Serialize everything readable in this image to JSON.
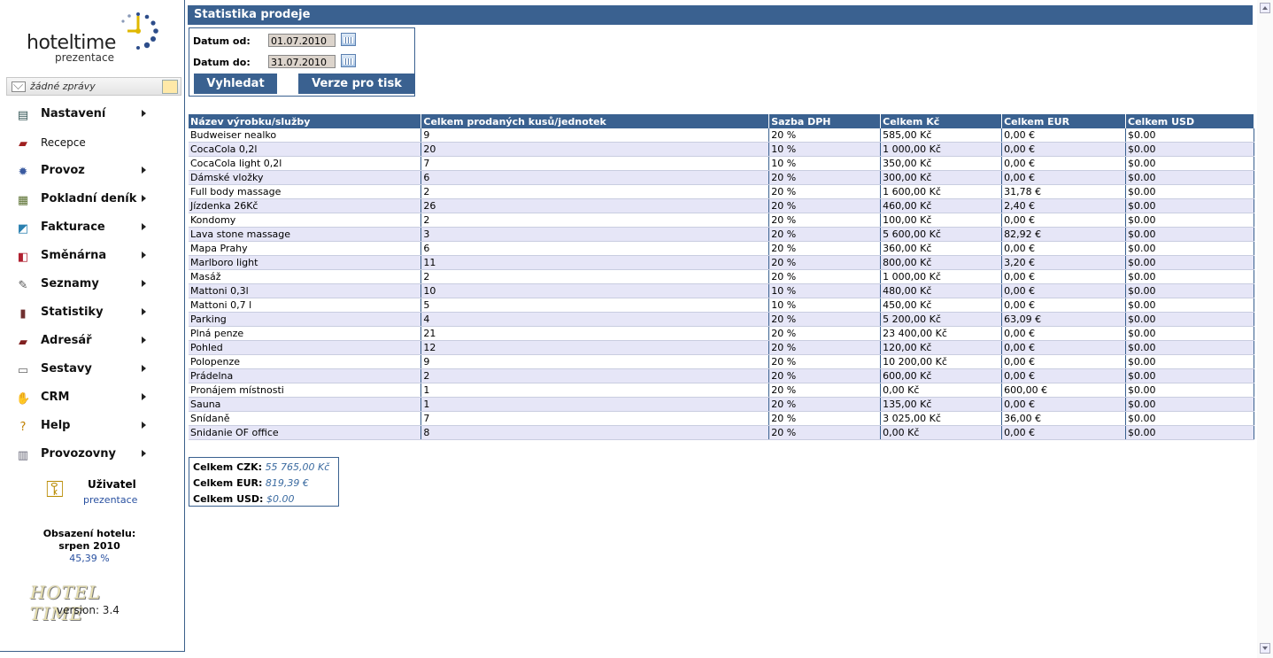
{
  "app": {
    "logo_text": "hoteltime",
    "logo_sub": "prezentace"
  },
  "messages": {
    "text": "žádné zprávy"
  },
  "menu": [
    {
      "label": "Nastavení",
      "icon": "settings-list-icon",
      "glyph": "▤",
      "color": "#355",
      "arrow": true
    },
    {
      "label": "Recepce",
      "icon": "reception-icon",
      "glyph": "▰",
      "color": "#a02020",
      "arrow": false
    },
    {
      "label": "Provoz",
      "icon": "gear-icon",
      "glyph": "✹",
      "color": "#3a5aa0",
      "arrow": true
    },
    {
      "label": "Pokladní deník",
      "icon": "cash-book-icon",
      "glyph": "▦",
      "color": "#5a7030",
      "arrow": true
    },
    {
      "label": "Fakturace",
      "icon": "invoice-icon",
      "glyph": "◩",
      "color": "#2a80b0",
      "arrow": true
    },
    {
      "label": "Směnárna",
      "icon": "exchange-icon",
      "glyph": "◧",
      "color": "#b02030",
      "arrow": true
    },
    {
      "label": "Seznamy",
      "icon": "lists-icon",
      "glyph": "✎",
      "color": "#555",
      "arrow": true
    },
    {
      "label": "Statistiky",
      "icon": "statistics-icon",
      "glyph": "▮",
      "color": "#703030",
      "arrow": true
    },
    {
      "label": "Adresář",
      "icon": "address-book-icon",
      "glyph": "▰",
      "color": "#802020",
      "arrow": true
    },
    {
      "label": "Sestavy",
      "icon": "printer-icon",
      "glyph": "▭",
      "color": "#666",
      "arrow": true
    },
    {
      "label": "CRM",
      "icon": "crm-icon",
      "glyph": "✋",
      "color": "#d0a000",
      "arrow": true
    },
    {
      "label": "Help",
      "icon": "help-icon",
      "glyph": "?",
      "color": "#c08000",
      "arrow": true
    },
    {
      "label": "Provozovny",
      "icon": "building-icon",
      "glyph": "▥",
      "color": "#667",
      "arrow": true
    }
  ],
  "user": {
    "title": "Uživatel",
    "name": "prezentace"
  },
  "occupancy": {
    "heading_1": "Obsazení hotelu:",
    "heading_2": "srpen 2010",
    "percent": "45,39 %"
  },
  "brand": {
    "text": "HOTEL TIME",
    "version": "version: 3.4"
  },
  "page": {
    "title": "Statistika prodeje"
  },
  "filter": {
    "from_label": "Datum od:",
    "from_value": "01.07.2010",
    "to_label": "Datum do:",
    "to_value": "31.07.2010",
    "search_button": "Vyhledat",
    "print_button": "Verze pro tisk"
  },
  "table": {
    "columns": [
      "Název výrobku/služby",
      "Celkem prodaných kusů/jednotek",
      "Sazba DPH",
      "Celkem Kč",
      "Celkem EUR",
      "Celkem USD"
    ],
    "rows": [
      [
        "Budweiser nealko",
        "9",
        "20 %",
        "585,00 Kč",
        "0,00 €",
        "$0.00"
      ],
      [
        "CocaCola 0,2l",
        "20",
        "10 %",
        "1 000,00 Kč",
        "0,00 €",
        "$0.00"
      ],
      [
        "CocaCola light 0,2l",
        "7",
        "10 %",
        "350,00 Kč",
        "0,00 €",
        "$0.00"
      ],
      [
        "Dámské vložky",
        "6",
        "20 %",
        "300,00 Kč",
        "0,00 €",
        "$0.00"
      ],
      [
        "Full body massage",
        "2",
        "20 %",
        "1 600,00 Kč",
        "31,78 €",
        "$0.00"
      ],
      [
        "Jízdenka 26Kč",
        "26",
        "20 %",
        "460,00 Kč",
        "2,40 €",
        "$0.00"
      ],
      [
        "Kondomy",
        "2",
        "20 %",
        "100,00 Kč",
        "0,00 €",
        "$0.00"
      ],
      [
        "Lava stone massage",
        "3",
        "20 %",
        "5 600,00 Kč",
        "82,92 €",
        "$0.00"
      ],
      [
        "Mapa Prahy",
        "6",
        "20 %",
        "360,00 Kč",
        "0,00 €",
        "$0.00"
      ],
      [
        "Marlboro light",
        "11",
        "20 %",
        "800,00 Kč",
        "3,20 €",
        "$0.00"
      ],
      [
        "Masáž",
        "2",
        "20 %",
        "1 000,00 Kč",
        "0,00 €",
        "$0.00"
      ],
      [
        "Mattoni 0,3l",
        "10",
        "10 %",
        "480,00 Kč",
        "0,00 €",
        "$0.00"
      ],
      [
        "Mattoni 0,7 l",
        "5",
        "10 %",
        "450,00 Kč",
        "0,00 €",
        "$0.00"
      ],
      [
        "Parking",
        "4",
        "20 %",
        "5 200,00 Kč",
        "63,09 €",
        "$0.00"
      ],
      [
        "Plná penze",
        "21",
        "20 %",
        "23 400,00 Kč",
        "0,00 €",
        "$0.00"
      ],
      [
        "Pohled",
        "12",
        "20 %",
        "120,00 Kč",
        "0,00 €",
        "$0.00"
      ],
      [
        "Polopenze",
        "9",
        "20 %",
        "10 200,00 Kč",
        "0,00 €",
        "$0.00"
      ],
      [
        "Prádelna",
        "2",
        "20 %",
        "600,00 Kč",
        "0,00 €",
        "$0.00"
      ],
      [
        "Pronájem místnosti",
        "1",
        "20 %",
        "0,00 Kč",
        "600,00 €",
        "$0.00"
      ],
      [
        "Sauna",
        "1",
        "20 %",
        "135,00 Kč",
        "0,00 €",
        "$0.00"
      ],
      [
        "Snídaně",
        "7",
        "20 %",
        "3 025,00 Kč",
        "36,00 €",
        "$0.00"
      ],
      [
        "Snidanie OF office",
        "8",
        "20 %",
        "0,00 Kč",
        "0,00 €",
        "$0.00"
      ]
    ]
  },
  "totals": {
    "czk_label": "Celkem CZK:",
    "czk_value": "55 765,00 Kč",
    "eur_label": "Celkem EUR:",
    "eur_value": "819,39 €",
    "usd_label": "Celkem USD:",
    "usd_value": "$0.00"
  },
  "colors": {
    "header": "#3a6190",
    "row_alt": "#e6e6f7",
    "accent_link": "#2850a0"
  }
}
